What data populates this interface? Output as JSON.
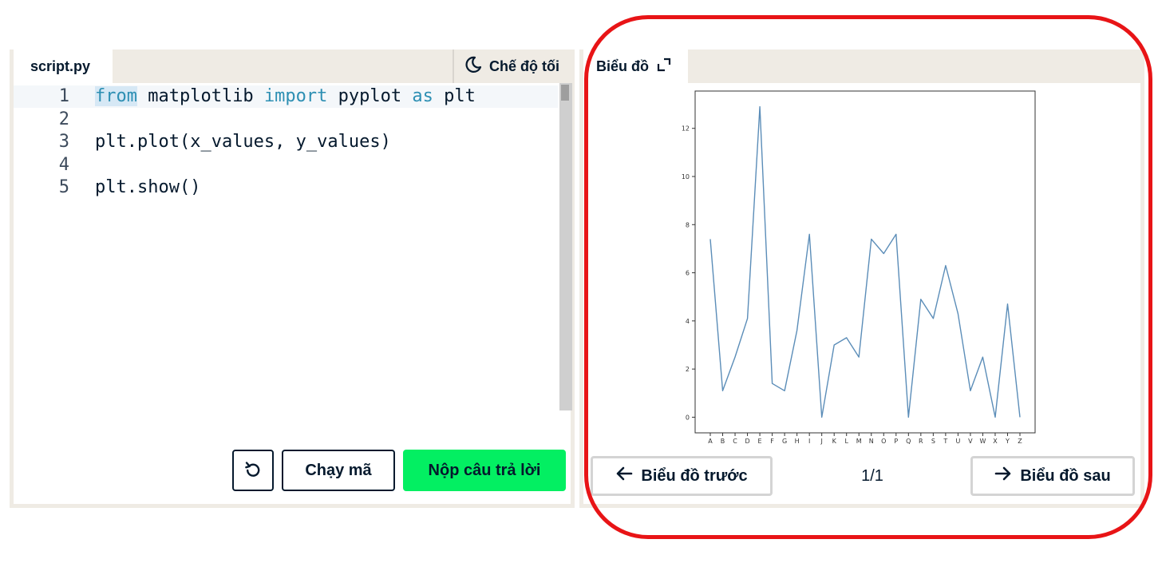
{
  "editor": {
    "tab_label": "script.py",
    "dark_mode_label": "Chế độ tối",
    "lines": [
      {
        "num": "1",
        "tokens": [
          {
            "t": "from",
            "cls": "kw-sel"
          },
          {
            "t": " matplotlib ",
            "cls": ""
          },
          {
            "t": "import",
            "cls": "kw"
          },
          {
            "t": " pyplot ",
            "cls": ""
          },
          {
            "t": "as",
            "cls": "kw"
          },
          {
            "t": " plt",
            "cls": ""
          }
        ]
      },
      {
        "num": "2",
        "tokens": []
      },
      {
        "num": "3",
        "tokens": [
          {
            "t": "plt.plot(x_values, y_values)",
            "cls": ""
          }
        ]
      },
      {
        "num": "4",
        "tokens": []
      },
      {
        "num": "5",
        "tokens": [
          {
            "t": "plt.show()",
            "cls": ""
          }
        ]
      }
    ],
    "run_label": "Chạy mã",
    "submit_label": "Nộp câu trả lời"
  },
  "plots": {
    "tab_label": "Biểu đồ",
    "prev_label": "Biểu đồ trước",
    "next_label": "Biểu đồ sau",
    "page_indicator": "1/1"
  },
  "colors": {
    "accent_green": "#03ef62",
    "line_color": "#5b8db8",
    "annotation_red": "#e81416"
  },
  "chart_data": {
    "type": "line",
    "x": [
      "A",
      "B",
      "C",
      "D",
      "E",
      "F",
      "G",
      "H",
      "I",
      "J",
      "K",
      "L",
      "M",
      "N",
      "O",
      "P",
      "Q",
      "R",
      "S",
      "T",
      "U",
      "V",
      "W",
      "X",
      "Y",
      "Z"
    ],
    "values": [
      7.4,
      1.1,
      2.5,
      4.1,
      12.9,
      1.4,
      1.1,
      3.6,
      7.6,
      0,
      3.0,
      3.3,
      2.5,
      7.4,
      6.8,
      7.6,
      0,
      4.9,
      4.1,
      6.3,
      4.3,
      1.1,
      2.5,
      0,
      4.7,
      0
    ],
    "yticks": [
      0,
      2,
      4,
      6,
      8,
      10,
      12
    ],
    "ylim": [
      -0.65,
      13.55
    ],
    "title": "",
    "xlabel": "",
    "ylabel": "",
    "grid": false
  }
}
